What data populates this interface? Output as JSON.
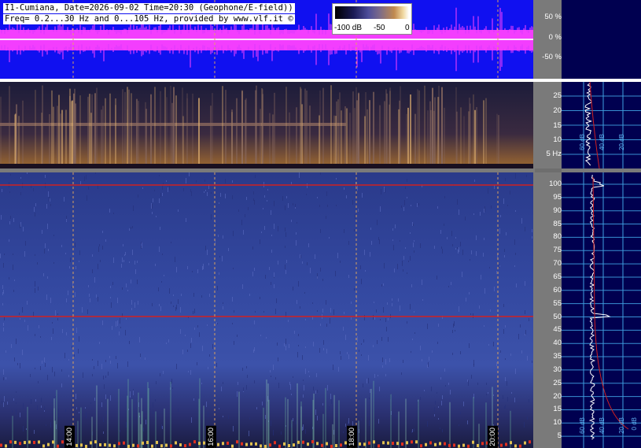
{
  "header": {
    "line1": "I1-Cumiana, Date=2026-09-02 Time=20:30 (Geophone/E-field))",
    "line2": "Freq= 0.2...30 Hz and 0...105 Hz, provided by www.vlf.it ©"
  },
  "colorbar": {
    "labels": [
      "-100 dB",
      "-50",
      "0"
    ]
  },
  "wave_scale": [
    "50 %",
    "0 %",
    "-50 %"
  ],
  "spec1_scale": [
    "25",
    "20",
    "15",
    "10",
    "5 Hz"
  ],
  "spec2_scale": [
    "100",
    "95",
    "90",
    "85",
    "80",
    "75",
    "70",
    "65",
    "60",
    "55",
    "50",
    "45",
    "40",
    "35",
    "30",
    "25",
    "20",
    "15",
    "10",
    "5"
  ],
  "time_labels": [
    "14:00",
    "16:00",
    "18:00",
    "20:00"
  ],
  "right_panel": {
    "top_db_labels": [
      "60 dB",
      "40 dB",
      "20 dB"
    ],
    "bottom_db_labels": [
      "60 dB",
      "40 dB",
      "20 dB",
      "0 dB"
    ]
  },
  "colors": {
    "wave_bg": "#1010f0",
    "wave_signal": "#ff40ff",
    "marker_line": "#d02020",
    "grid": "#3fa0e0"
  }
}
